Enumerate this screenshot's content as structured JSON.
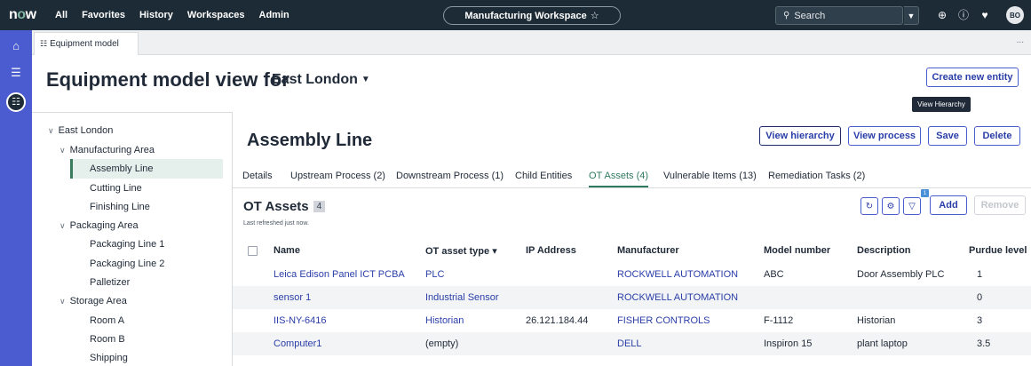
{
  "topnav": {
    "logo_prefix": "n",
    "logo_o": "o",
    "logo_suffix": "w",
    "links": [
      "All",
      "Favorites",
      "History",
      "Workspaces",
      "Admin"
    ],
    "workspace": "Manufacturing Workspace",
    "workspace_star": "☆",
    "search_placeholder": "Search",
    "avatar": "BO",
    "icons": [
      "globe-icon",
      "help-icon",
      "bell-icon"
    ]
  },
  "rail": {
    "icons": [
      "home-icon",
      "list-icon",
      "hierarchy-icon"
    ]
  },
  "tabbar": {
    "tab_label": "Equipment model",
    "more": "..."
  },
  "header": {
    "title": "Equipment model view for",
    "location": "East London",
    "create_button": "Create new entity",
    "tooltip": "View Hierarchy"
  },
  "tree": {
    "nodes": [
      {
        "label": "East London",
        "level": 0,
        "expanded": true
      },
      {
        "label": "Manufacturing Area",
        "level": 1,
        "expanded": true
      },
      {
        "label": "Assembly Line",
        "level": 2,
        "selected": true
      },
      {
        "label": "Cutting Line",
        "level": 2
      },
      {
        "label": "Finishing Line",
        "level": 2
      },
      {
        "label": "Packaging Area",
        "level": 1,
        "expanded": true
      },
      {
        "label": "Packaging Line 1",
        "level": 2
      },
      {
        "label": "Packaging Line 2",
        "level": 2
      },
      {
        "label": "Palletizer",
        "level": 2
      },
      {
        "label": "Storage Area",
        "level": 1,
        "expanded": true
      },
      {
        "label": "Room A",
        "level": 2
      },
      {
        "label": "Room B",
        "level": 2
      },
      {
        "label": "Shipping",
        "level": 2
      }
    ]
  },
  "detail": {
    "title": "Assembly Line",
    "buttons": {
      "view_hierarchy": "View hierarchy",
      "view_process": "View process",
      "save": "Save",
      "delete": "Delete"
    },
    "tabs": [
      "Details",
      "Upstream Process (2)",
      "Downstream Process (1)",
      "Child Entities",
      "OT Assets (4)",
      "Vulnerable Items (13)",
      "Remediation Tasks (2)"
    ],
    "active_tab": "OT Assets (4)"
  },
  "ot_assets": {
    "title": "OT Assets",
    "count": "4",
    "refreshed": "Last refreshed just now.",
    "filter_badge": "1",
    "add_button": "Add",
    "remove_button": "Remove",
    "columns": [
      "Name",
      "OT asset type",
      "IP Address",
      "Manufacturer",
      "Model number",
      "Description",
      "Purdue level"
    ],
    "sort_indicator": "▾",
    "rows": [
      {
        "name": "Leica Edison Panel ICT PCBA",
        "type": "PLC",
        "ip": "",
        "manufacturer": "ROCKWELL AUTOMATION",
        "model": "ABC",
        "description": "Door Assembly PLC",
        "purdue": "1"
      },
      {
        "name": "sensor 1",
        "type": "Industrial Sensor",
        "ip": "",
        "manufacturer": "ROCKWELL AUTOMATION",
        "model": "",
        "description": "",
        "purdue": "0"
      },
      {
        "name": "IIS-NY-6416",
        "type": "Historian",
        "ip": "26.121.184.44",
        "manufacturer": "FISHER CONTROLS",
        "model": "F-1112",
        "description": "Historian",
        "purdue": "3"
      },
      {
        "name": "Computer1",
        "type": "(empty)",
        "ip": "",
        "manufacturer": "DELL",
        "model": "Inspiron 15",
        "description": "plant laptop",
        "purdue": "3.5"
      }
    ]
  }
}
